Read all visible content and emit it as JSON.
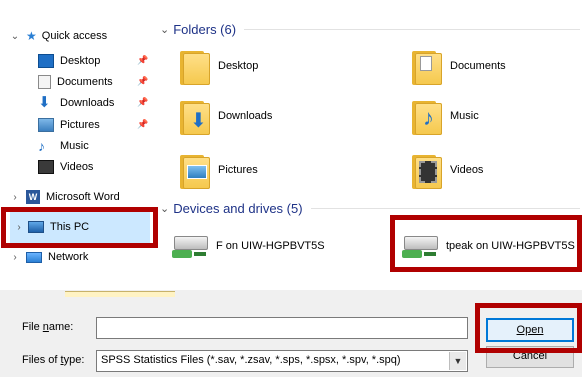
{
  "nav": {
    "quick_access": "Quick access",
    "desktop": "Desktop",
    "documents": "Documents",
    "downloads": "Downloads",
    "pictures": "Pictures",
    "music": "Music",
    "videos": "Videos",
    "microsoft_word": "Microsoft Word",
    "this_pc": "This PC",
    "network": "Network"
  },
  "content": {
    "folders_header": "Folders (6)",
    "folders": [
      "Desktop",
      "Documents",
      "Downloads",
      "Music",
      "Pictures",
      "Videos"
    ],
    "devices_header": "Devices and drives (5)",
    "drives": [
      "F on UIW-HGPBVT5S",
      "tpeak on UIW-HGPBVT5S"
    ]
  },
  "dialog": {
    "file_name_label_pre": "File ",
    "file_name_label_u": "n",
    "file_name_label_post": "ame:",
    "file_name_value": "",
    "files_of_type_label_pre": "Files of ",
    "files_of_type_label_u": "t",
    "files_of_type_label_post": "ype:",
    "files_of_type_value": "SPSS Statistics Files (*.sav, *.zsav, *.sps, *.spsx, *.spv, *.spq)",
    "open_label": "Open",
    "cancel_label": "Cancel"
  },
  "colors": {
    "highlight_red": "#b00000",
    "selection_blue": "#cce8ff",
    "header_blue": "#1e3287"
  }
}
